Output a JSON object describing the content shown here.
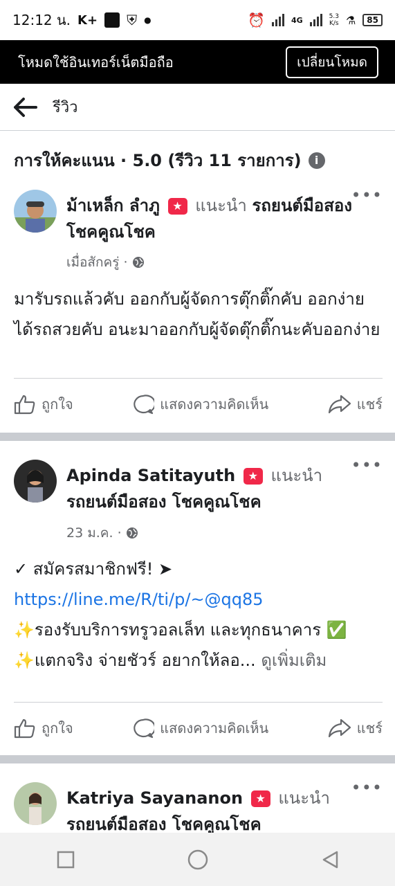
{
  "status_bar": {
    "time": "12:12 น.",
    "carrier_icon": "K+",
    "network": "4G",
    "speed_value": "5.3",
    "speed_unit": "K/s",
    "battery": "85"
  },
  "mode_bar": {
    "text": "โหมดใช้อินเทอร์เน็ตมือถือ",
    "button": "เปลี่ยนโหมด"
  },
  "nav": {
    "title": "รีวิว"
  },
  "rating": {
    "header": "การให้คะแนน · 5.0 (รีวิว 11 รายการ)"
  },
  "reviews": [
    {
      "name": "ม้าเหล็ก ลำภู",
      "recommends": "แนะนำ",
      "page": "รถยนต์มือสอง โชคคูณโชค",
      "time": "เมื่อสักครู่ ·",
      "text": "มารับรถแล้วคับ ออกกับผู้จัดการตุ๊กติ๊กคับ ออกง่ายได้รถสวยคับ อนะมาออกกับผู้จัดตุ๊กติ๊กนะคับออกง่าย"
    },
    {
      "name": "Apinda Satitayuth",
      "recommends": "แนะนำ",
      "page": "รถยนต์มือสอง โชคคูณโชค",
      "time": "23 ม.ค. ·",
      "line1": "✓ สมัครสมาชิกฟรี! ➤",
      "link": "https://line.me/R/ti/p/~@qq85",
      "line2": "✨รองรับบริการทรูวอลเล็ท และทุกธนาคาร ✅",
      "line3": "✨แตกจริง จ่ายชัวร์ อยากให้ลอ...",
      "see_more": "ดูเพิ่มเติม"
    },
    {
      "name": "Katriya Sayananon",
      "recommends": "แนะนำ",
      "page": "รถยนต์มือสอง โชคคูณโชค"
    }
  ],
  "actions": {
    "like": "ถูกใจ",
    "comment": "แสดงความคิดเห็น",
    "share": "แชร์"
  },
  "colors": {
    "link": "#1b74e4",
    "badge": "#f02849",
    "secondary_text": "#65676b"
  }
}
